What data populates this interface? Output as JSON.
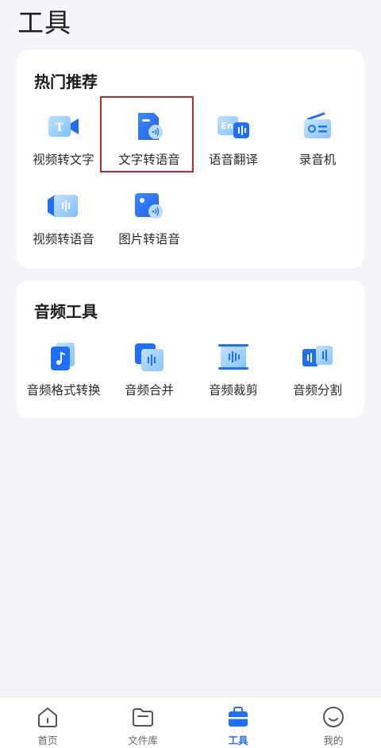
{
  "page": {
    "title": "工具"
  },
  "hot": {
    "title": "热门推荐",
    "items": [
      {
        "label": "视频转文字",
        "icon": "video-to-text-icon"
      },
      {
        "label": "文字转语音",
        "icon": "text-to-speech-icon"
      },
      {
        "label": "语音翻译",
        "icon": "speech-translate-icon"
      },
      {
        "label": "录音机",
        "icon": "recorder-icon"
      },
      {
        "label": "视频转语音",
        "icon": "video-to-speech-icon"
      },
      {
        "label": "图片转语音",
        "icon": "image-to-speech-icon"
      }
    ]
  },
  "audio": {
    "title": "音频工具",
    "items": [
      {
        "label": "音频格式转换",
        "icon": "audio-format-convert-icon"
      },
      {
        "label": "音频合并",
        "icon": "audio-merge-icon"
      },
      {
        "label": "音频裁剪",
        "icon": "audio-trim-icon"
      },
      {
        "label": "音频分割",
        "icon": "audio-split-icon"
      }
    ]
  },
  "tabs": [
    {
      "label": "首页",
      "icon": "home-icon",
      "active": false
    },
    {
      "label": "文件库",
      "icon": "folder-icon",
      "active": false
    },
    {
      "label": "工具",
      "icon": "toolbox-icon",
      "active": true
    },
    {
      "label": "我的",
      "icon": "profile-icon",
      "active": false
    }
  ],
  "colors": {
    "accent": "#1f6fff",
    "icon_light": "#9fd0ff",
    "highlight_border": "#c0282b",
    "background": "#f4f5f9"
  }
}
